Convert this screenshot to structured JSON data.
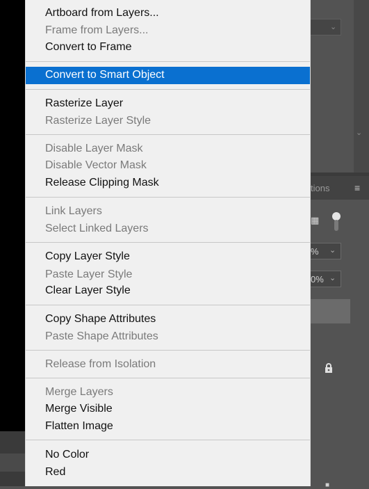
{
  "menu": {
    "groups": [
      {
        "items": [
          {
            "label": "Artboard from Layers...",
            "enabled": true
          },
          {
            "label": "Frame from Layers...",
            "enabled": false
          },
          {
            "label": "Convert to Frame",
            "enabled": true
          }
        ]
      },
      {
        "items": [
          {
            "label": "Convert to Smart Object",
            "enabled": true,
            "highlighted": true
          }
        ]
      },
      {
        "items": [
          {
            "label": "Rasterize Layer",
            "enabled": true
          },
          {
            "label": "Rasterize Layer Style",
            "enabled": false
          }
        ]
      },
      {
        "items": [
          {
            "label": "Disable Layer Mask",
            "enabled": false
          },
          {
            "label": "Disable Vector Mask",
            "enabled": false
          },
          {
            "label": "Release Clipping Mask",
            "enabled": true
          }
        ]
      },
      {
        "items": [
          {
            "label": "Link Layers",
            "enabled": false
          },
          {
            "label": "Select Linked Layers",
            "enabled": false
          }
        ]
      },
      {
        "items": [
          {
            "label": "Copy Layer Style",
            "enabled": true
          },
          {
            "label": "Paste Layer Style",
            "enabled": false
          },
          {
            "label": "Clear Layer Style",
            "enabled": true
          }
        ]
      },
      {
        "items": [
          {
            "label": "Copy Shape Attributes",
            "enabled": true
          },
          {
            "label": "Paste Shape Attributes",
            "enabled": false
          }
        ]
      },
      {
        "items": [
          {
            "label": "Release from Isolation",
            "enabled": false
          }
        ]
      },
      {
        "items": [
          {
            "label": "Merge Layers",
            "enabled": false
          },
          {
            "label": "Merge Visible",
            "enabled": true
          },
          {
            "label": "Flatten Image",
            "enabled": true
          }
        ]
      },
      {
        "items": [
          {
            "label": "No Color",
            "enabled": true
          },
          {
            "label": "Red",
            "enabled": true
          }
        ]
      }
    ]
  },
  "background_panel": {
    "tab_label_partial": "tions",
    "opacity_partial": "%",
    "fill_partial": "0%"
  },
  "colors": {
    "highlight": "#0a70d0",
    "menu_bg": "#f0f0f0",
    "enabled_text": "#111111",
    "disabled_text": "#7a7a7a"
  },
  "icons": {
    "panel_menu": "hamburger-icon",
    "lock": "lock-icon"
  }
}
